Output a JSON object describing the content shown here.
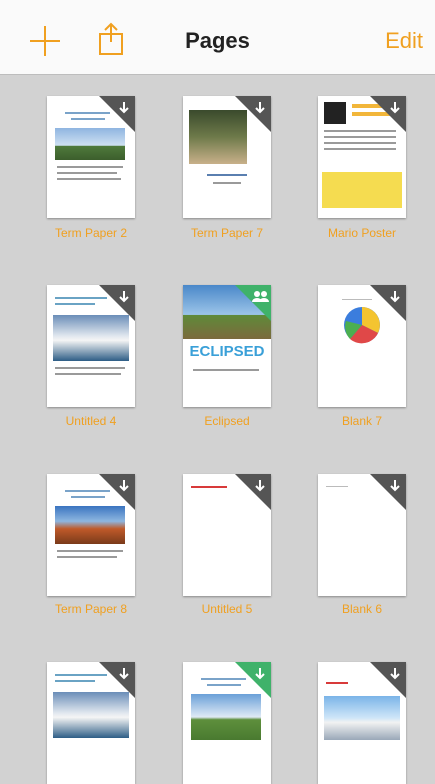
{
  "nav": {
    "title": "Pages",
    "edit": "Edit",
    "add_icon": "plus-icon",
    "share_icon": "share-icon"
  },
  "documents": [
    {
      "name": "Term Paper 2",
      "corner": "download",
      "accent": "#555555"
    },
    {
      "name": "Term Paper 7",
      "corner": "download",
      "accent": "#555555"
    },
    {
      "name": "Mario Poster",
      "corner": "download",
      "accent": "#555555"
    },
    {
      "name": "Untitled 4",
      "corner": "download",
      "accent": "#555555"
    },
    {
      "name": "Eclipsed",
      "corner": "shared",
      "accent": "#3fb26a",
      "cover_text": "ECLIPSED"
    },
    {
      "name": "Blank 7",
      "corner": "download",
      "accent": "#555555"
    },
    {
      "name": "Term Paper 8",
      "corner": "download",
      "accent": "#555555"
    },
    {
      "name": "Untitled 5",
      "corner": "download",
      "accent": "#555555"
    },
    {
      "name": "Blank 6",
      "corner": "download",
      "accent": "#555555"
    },
    {
      "name": "",
      "corner": "download",
      "accent": "#555555"
    },
    {
      "name": "",
      "corner": "download",
      "accent": "#3fb26a"
    },
    {
      "name": "",
      "corner": "download",
      "accent": "#555555"
    }
  ],
  "colors": {
    "accent": "#f0a020",
    "background": "#d2d2d2"
  }
}
